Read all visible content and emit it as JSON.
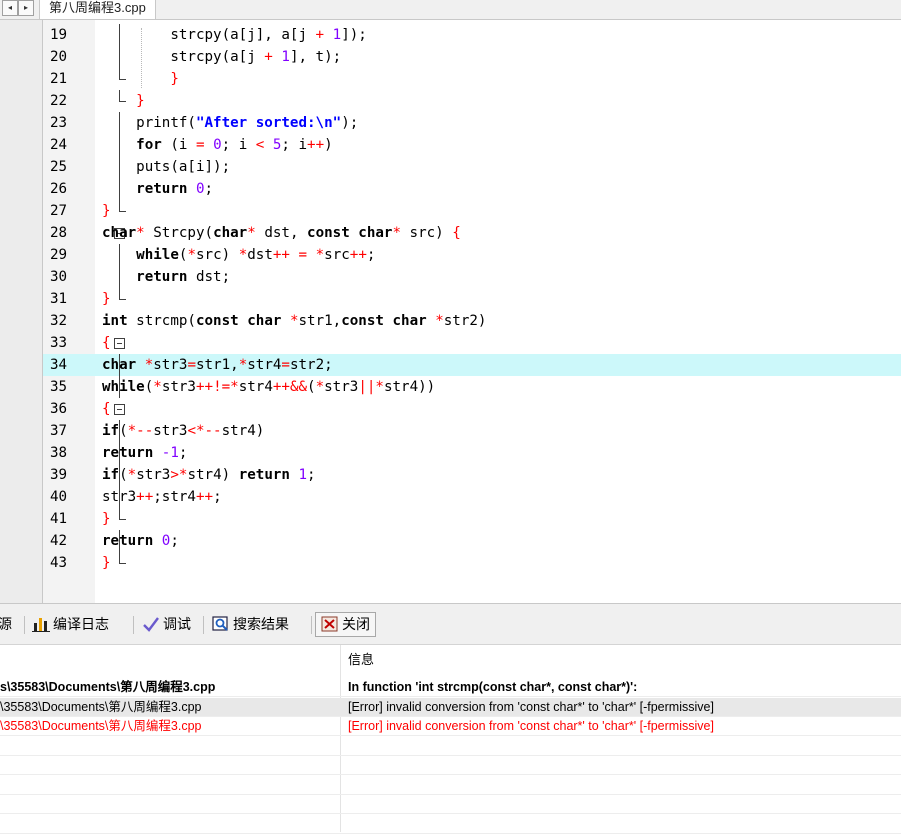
{
  "tabs": {
    "nav_prev": "◂",
    "nav_next": "▸",
    "active_file": "第八周编程3.cpp"
  },
  "editor": {
    "lines": [
      {
        "n": "19",
        "tokens": [
          [
            "        strcpy(a[j], a[j ",
            ""
          ],
          [
            "+",
            "o"
          ],
          [
            " 1",
            "n"
          ],
          [
            "]);",
            ""
          ]
        ]
      },
      {
        "n": "20",
        "tokens": [
          [
            "        strcpy(a[j ",
            ""
          ],
          [
            "+",
            "o"
          ],
          [
            " 1",
            "n"
          ],
          [
            "], t);",
            ""
          ]
        ]
      },
      {
        "n": "21",
        "tokens": [
          [
            "        ",
            ""
          ],
          [
            "}",
            "o"
          ]
        ]
      },
      {
        "n": "22",
        "tokens": [
          [
            "    ",
            ""
          ],
          [
            "}",
            "o"
          ]
        ]
      },
      {
        "n": "23",
        "tokens": [
          [
            "    printf(",
            ""
          ],
          [
            "\"After sorted:\\n\"",
            "s"
          ],
          [
            ");",
            ""
          ]
        ]
      },
      {
        "n": "24",
        "tokens": [
          [
            "    ",
            ""
          ],
          [
            "for",
            "k"
          ],
          [
            " (i ",
            ""
          ],
          [
            "=",
            "o"
          ],
          [
            " ",
            ""
          ],
          [
            "0",
            "n"
          ],
          [
            "; i ",
            ""
          ],
          [
            "<",
            "o"
          ],
          [
            " ",
            ""
          ],
          [
            "5",
            "n"
          ],
          [
            "; i",
            ""
          ],
          [
            "++",
            "o"
          ],
          [
            ")",
            ""
          ]
        ]
      },
      {
        "n": "25",
        "tokens": [
          [
            "    puts(a[i]);",
            ""
          ]
        ]
      },
      {
        "n": "26",
        "tokens": [
          [
            "    ",
            ""
          ],
          [
            "return",
            "k"
          ],
          [
            " ",
            ""
          ],
          [
            "0",
            "n"
          ],
          [
            ";",
            ""
          ]
        ]
      },
      {
        "n": "27",
        "tokens": [
          [
            "}",
            "o"
          ]
        ]
      },
      {
        "n": "28",
        "tokens": [
          [
            "char",
            "k"
          ],
          [
            "*",
            "o"
          ],
          [
            " Strcpy(",
            ""
          ],
          [
            "char",
            "k"
          ],
          [
            "*",
            "o"
          ],
          [
            " dst, ",
            ""
          ],
          [
            "const",
            "k"
          ],
          [
            " ",
            ""
          ],
          [
            "char",
            "k"
          ],
          [
            "*",
            "o"
          ],
          [
            " src) ",
            ""
          ],
          [
            "{",
            "o"
          ]
        ]
      },
      {
        "n": "29",
        "tokens": [
          [
            "    ",
            ""
          ],
          [
            "while",
            "k"
          ],
          [
            "(",
            ""
          ],
          [
            "*",
            "o"
          ],
          [
            "src) ",
            ""
          ],
          [
            "*",
            "o"
          ],
          [
            "dst",
            ""
          ],
          [
            "++",
            "o"
          ],
          [
            " ",
            ""
          ],
          [
            "=",
            "o"
          ],
          [
            " ",
            ""
          ],
          [
            "*",
            "o"
          ],
          [
            "src",
            ""
          ],
          [
            "++",
            "o"
          ],
          [
            ";",
            ""
          ]
        ]
      },
      {
        "n": "30",
        "tokens": [
          [
            "    ",
            ""
          ],
          [
            "return",
            "k"
          ],
          [
            " dst;",
            ""
          ]
        ]
      },
      {
        "n": "31",
        "tokens": [
          [
            "}",
            "o"
          ]
        ]
      },
      {
        "n": "32",
        "tokens": [
          [
            "int",
            "k"
          ],
          [
            " strcmp(",
            ""
          ],
          [
            "const",
            "k"
          ],
          [
            " ",
            ""
          ],
          [
            "char",
            "k"
          ],
          [
            " ",
            ""
          ],
          [
            "*",
            "o"
          ],
          [
            "str1,",
            ""
          ],
          [
            "const",
            "k"
          ],
          [
            " ",
            ""
          ],
          [
            "char",
            "k"
          ],
          [
            " ",
            ""
          ],
          [
            "*",
            "o"
          ],
          [
            "str2)",
            ""
          ]
        ]
      },
      {
        "n": "33",
        "tokens": [
          [
            "{",
            "o"
          ]
        ]
      },
      {
        "n": "34",
        "tokens": [
          [
            "char",
            "k"
          ],
          [
            " ",
            ""
          ],
          [
            "*",
            "o"
          ],
          [
            "str3",
            ""
          ],
          [
            "=",
            "o"
          ],
          [
            "str1,",
            ""
          ],
          [
            "*",
            "o"
          ],
          [
            "str4",
            ""
          ],
          [
            "=",
            "o"
          ],
          [
            "str2;",
            ""
          ]
        ]
      },
      {
        "n": "35",
        "tokens": [
          [
            "while",
            "k"
          ],
          [
            "(",
            ""
          ],
          [
            "*",
            "o"
          ],
          [
            "str3",
            ""
          ],
          [
            "++!=*",
            "o"
          ],
          [
            "str4",
            ""
          ],
          [
            "++&&",
            "o"
          ],
          [
            "(",
            ""
          ],
          [
            "*",
            "o"
          ],
          [
            "str3",
            ""
          ],
          [
            "||",
            "o"
          ],
          [
            "*",
            "o"
          ],
          [
            "str4))",
            ""
          ]
        ]
      },
      {
        "n": "36",
        "tokens": [
          [
            "{",
            "o"
          ]
        ]
      },
      {
        "n": "37",
        "tokens": [
          [
            "if",
            "k"
          ],
          [
            "(",
            ""
          ],
          [
            "*--",
            "o"
          ],
          [
            "str3",
            ""
          ],
          [
            "<*--",
            "o"
          ],
          [
            "str4)",
            ""
          ]
        ]
      },
      {
        "n": "38",
        "tokens": [
          [
            "return",
            "k"
          ],
          [
            " ",
            ""
          ],
          [
            "-1",
            "n"
          ],
          [
            ";",
            ""
          ]
        ]
      },
      {
        "n": "39",
        "tokens": [
          [
            "if",
            "k"
          ],
          [
            "(",
            ""
          ],
          [
            "*",
            "o"
          ],
          [
            "str3",
            ""
          ],
          [
            ">*",
            "o"
          ],
          [
            "str4) ",
            ""
          ],
          [
            "return",
            "k"
          ],
          [
            " ",
            ""
          ],
          [
            "1",
            "n"
          ],
          [
            ";",
            ""
          ]
        ]
      },
      {
        "n": "40",
        "tokens": [
          [
            "str3",
            ""
          ],
          [
            "++",
            "o"
          ],
          [
            ";str4",
            ""
          ],
          [
            "++",
            "o"
          ],
          [
            ";",
            ""
          ]
        ]
      },
      {
        "n": "41",
        "tokens": [
          [
            "}",
            "o"
          ]
        ]
      },
      {
        "n": "42",
        "tokens": [
          [
            "return",
            "k"
          ],
          [
            " ",
            ""
          ],
          [
            "0",
            "n"
          ],
          [
            ";",
            ""
          ]
        ]
      },
      {
        "n": "43",
        "tokens": [
          [
            "}",
            "o"
          ]
        ]
      }
    ],
    "current_line": "34"
  },
  "bottom_tabs": {
    "resources": "源",
    "compile_log": "编译日志",
    "debug": "调试",
    "search_results": "搜索结果",
    "close": "关闭"
  },
  "messages": {
    "header": "信息",
    "rows": [
      {
        "file": "s\\35583\\Documents\\第八周编程3.cpp",
        "msg": "In function 'int strcmp(const char*, const char*)':",
        "style": "bold"
      },
      {
        "file": "\\35583\\Documents\\第八周编程3.cpp",
        "msg": "[Error] invalid conversion from 'const char*' to 'char*' [-fpermissive]",
        "style": "sel"
      },
      {
        "file": "\\35583\\Documents\\第八周编程3.cpp",
        "msg": "[Error] invalid conversion from 'const char*' to 'char*' [-fpermissive]",
        "style": "red"
      }
    ]
  },
  "colors": {
    "keyword": "#000000",
    "operator": "#ff0000",
    "number": "#8000ff",
    "string": "#0000ff",
    "current_line_bg": "#ccf8fa",
    "error_text": "#ff0000"
  }
}
